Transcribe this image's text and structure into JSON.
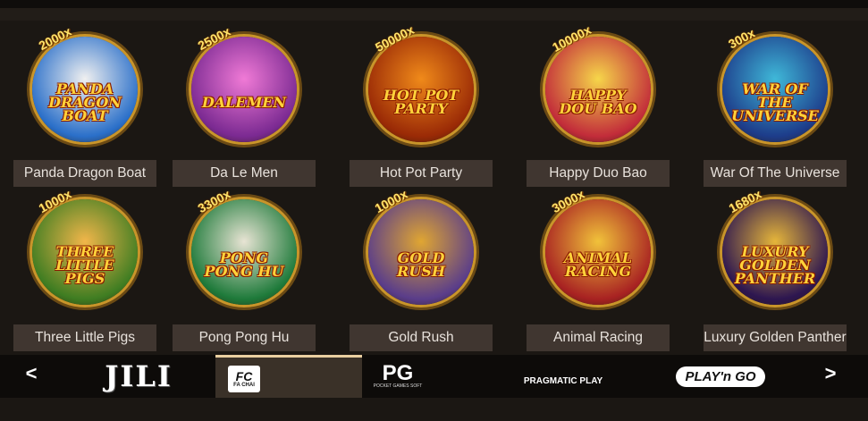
{
  "games": [
    {
      "name": "Panda Dragon Boat",
      "logo": "PANDA DRAGON BOAT",
      "mult": "2000x",
      "colors": [
        "#2a6fc9",
        "#f0f0f0"
      ]
    },
    {
      "name": "Da Le Men",
      "logo": "DALEMEN",
      "mult": "2500x",
      "colors": [
        "#7b2a92",
        "#f07ad6"
      ]
    },
    {
      "name": "Hot Pot Party",
      "logo": "HOT POT PARTY",
      "mult": "50000x",
      "colors": [
        "#9a2a06",
        "#f08a1a"
      ]
    },
    {
      "name": "Happy Duo Bao",
      "logo": "HAPPY DOU BAO",
      "mult": "10000x",
      "colors": [
        "#c22c3a",
        "#f6d64a"
      ]
    },
    {
      "name": "War Of The Universe",
      "logo": "WAR OF THE UNIVERSE",
      "mult": "300x",
      "colors": [
        "#1d3c8a",
        "#3fb8d8"
      ]
    },
    {
      "name": "Three Little Pigs",
      "logo": "THREE LITTLE PIGS",
      "mult": "1000x",
      "colors": [
        "#3f7d22",
        "#f2b64a"
      ]
    },
    {
      "name": "Pong Pong Hu",
      "logo": "PONG PONG HU",
      "mult": "3300x",
      "colors": [
        "#1e7a3a",
        "#e8e4d4"
      ]
    },
    {
      "name": "Gold Rush",
      "logo": "GOLD RUSH",
      "mult": "1000x",
      "colors": [
        "#5a3d8a",
        "#e0a632"
      ]
    },
    {
      "name": "Animal Racing",
      "logo": "ANIMAL RACING",
      "mult": "3000x",
      "colors": [
        "#a82222",
        "#f1c23a"
      ]
    },
    {
      "name": "Luxury Golden Panther",
      "logo": "LUXURY GOLDEN PANTHER",
      "mult": "1680x",
      "colors": [
        "#2d1650",
        "#e6b63a"
      ]
    }
  ],
  "providers": {
    "prev": "<",
    "next": ">",
    "jili": "JILI",
    "fc": "FC",
    "fc_sub": "FA CHAI",
    "pg": "PG",
    "pg_sub": "POCKET GAMES SOFT",
    "pragmatic": "PRAGMATIC PLAY",
    "playngo": "PLAY'n GO"
  }
}
